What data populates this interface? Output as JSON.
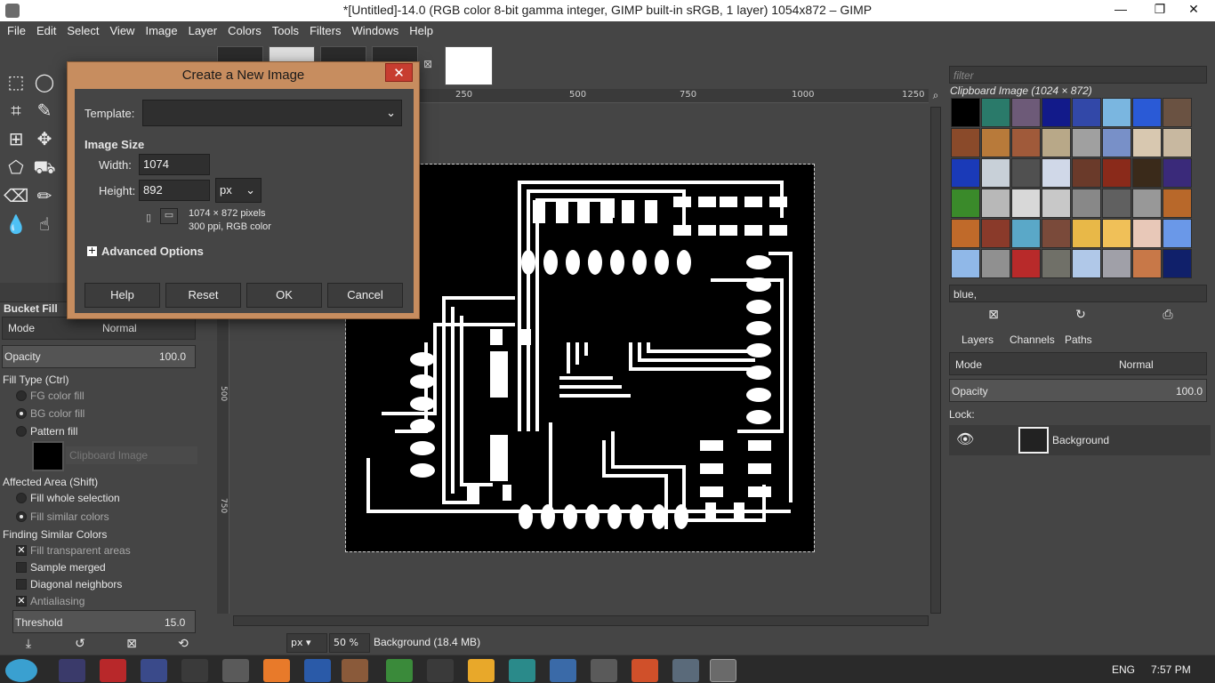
{
  "window": {
    "title": "*[Untitled]-14.0 (RGB color 8-bit gamma integer, GIMP built-in sRGB, 1 layer) 1054x872 – GIMP",
    "minimize": "—",
    "maximize": "❐",
    "close": "✕"
  },
  "menu": [
    "File",
    "Edit",
    "Select",
    "View",
    "Image",
    "Layer",
    "Colors",
    "Tools",
    "Filters",
    "Windows",
    "Help"
  ],
  "tool_options": {
    "title": "Bucket Fill",
    "mode_label": "Mode",
    "mode_value": "Normal",
    "opacity_label": "Opacity",
    "opacity_value": "100.0",
    "fill_type_label": "Fill Type  (Ctrl)",
    "fill_fg": "FG color fill",
    "fill_bg": "BG color fill",
    "fill_pattern": "Pattern fill",
    "pattern_name": "Clipboard Image",
    "affected_label": "Affected Area  (Shift)",
    "fill_whole": "Fill whole selection",
    "fill_similar": "Fill similar colors",
    "finding_label": "Finding Similar Colors",
    "fill_transparent": "Fill transparent areas",
    "sample_merged": "Sample merged",
    "diagonal": "Diagonal neighbors",
    "antialiasing": "Antialiasing",
    "threshold_label": "Threshold",
    "threshold_value": "15.0"
  },
  "rulers": {
    "top": [
      "250",
      "500",
      "750",
      "1000",
      "1250"
    ],
    "left": [
      "500",
      "750"
    ]
  },
  "statusbar": {
    "unit": "px",
    "zoom": "50 %",
    "layer_info": "Background (18.4 MB)"
  },
  "patterns": {
    "filter_placeholder": "filter",
    "heading": "Clipboard Image (1024 × 872)",
    "selected_name": "blue,"
  },
  "layers": {
    "tabs": [
      "Layers",
      "Channels",
      "Paths"
    ],
    "mode_label": "Mode",
    "mode_value": "Normal",
    "opacity_label": "Opacity",
    "opacity_value": "100.0",
    "lock_label": "Lock:",
    "layer_name": "Background"
  },
  "dialog": {
    "title": "Create a New Image",
    "template_label": "Template:",
    "template_value": "",
    "image_size_label": "Image Size",
    "width_label": "Width:",
    "width_value": "1074",
    "height_label": "Height:",
    "height_value": "892",
    "unit": "px",
    "info_pixels": "1074 × 872 pixels",
    "info_res": "300 ppi, RGB color",
    "advanced_label": "Advanced Options",
    "buttons": {
      "help": "Help",
      "reset": "Reset",
      "ok": "OK",
      "cancel": "Cancel"
    }
  },
  "taskbar": {
    "language": "ENG",
    "time": "7:57 PM"
  },
  "colors": {
    "dialog_frame": "#c78d5f",
    "close_red": "#c73d30",
    "background": "#454545"
  }
}
